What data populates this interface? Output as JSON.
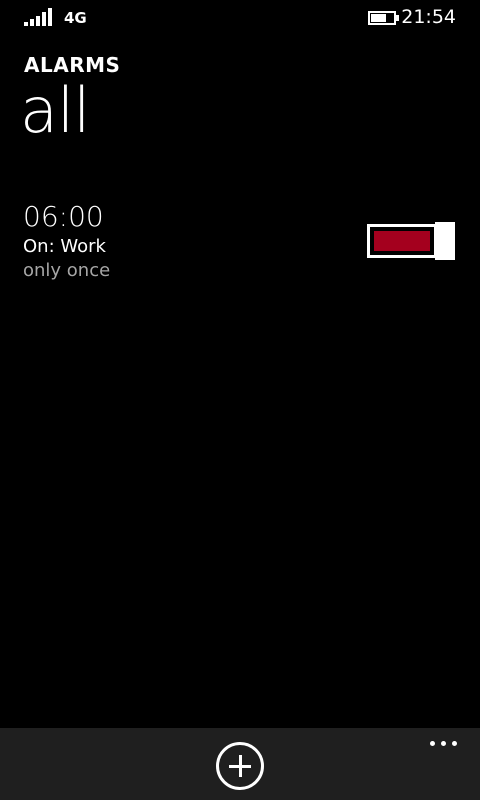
{
  "status_bar": {
    "network_type": "4G",
    "time": "21:54",
    "signal_icon": "signal-bars-icon",
    "battery_icon": "battery-icon",
    "battery_level": 0.7
  },
  "header": {
    "app_title": "ALARMS",
    "pivot_title": "all"
  },
  "alarms": [
    {
      "time": "06:00",
      "name": "On:  Work",
      "repeat": "only once",
      "enabled": true
    }
  ],
  "app_bar": {
    "add_icon": "add-circle-icon",
    "more_icon": "more-ellipsis-icon"
  },
  "colors": {
    "background": "#000000",
    "accent": "#a4001e",
    "app_bar": "#1f1f1f",
    "secondary_text": "#a6a6a6"
  }
}
